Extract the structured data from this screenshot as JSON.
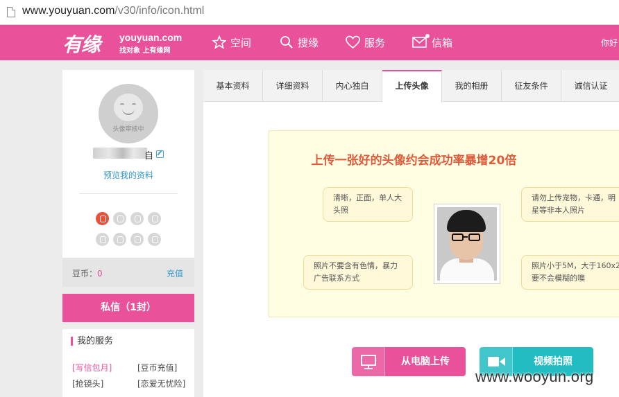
{
  "browser": {
    "url_host": "www.youyuan.com",
    "url_path": "/v30/info/icon.html"
  },
  "header": {
    "logo_cn": "有缘",
    "logo_en": "youyuan.com",
    "logo_slogan": "找对象 上有缘网",
    "nav": [
      {
        "label": "空间",
        "icon": "star-icon"
      },
      {
        "label": "搜缘",
        "icon": "search-icon"
      },
      {
        "label": "服务",
        "icon": "heart-icon"
      },
      {
        "label": "信箱",
        "icon": "mail-icon"
      }
    ],
    "greeting": "你好"
  },
  "profile": {
    "avatar_status": "头像审核中",
    "nickname_tail": "自",
    "preview_link": "预览我的资料",
    "coins_label": "豆币：",
    "coins_value": "0",
    "recharge_label": "充值",
    "private_msg_button": "私信（1封）"
  },
  "services": {
    "title": "我的服务",
    "items": [
      "[写信包月]",
      "[豆币充值]",
      "[抢镜头]",
      "[恋爱无忧险]"
    ]
  },
  "tabs": [
    "基本资料",
    "详细资料",
    "内心独白",
    "上传头像",
    "我的相册",
    "征友条件",
    "诚信认证"
  ],
  "active_tab": "上传头像",
  "upload": {
    "headline": "上传一张好的头像约会成功率暴增20倍",
    "tips": [
      "清晰，正面，单人大头照",
      "请勿上传宠物，卡通，明星等非本人照片",
      "照片不要含有色情，暴力广告联系方式",
      "照片小于5M，大于160x2要不会模糊的噢"
    ],
    "buttons": {
      "from_computer": "从电脑上传",
      "video_capture": "视频拍照"
    }
  },
  "watermark": "www.wooyun.org",
  "colors": {
    "brand_pink": "#e9519a",
    "teal": "#21bdc3",
    "link_blue": "#3399cc",
    "headline_red": "#e05a3a",
    "tip_bg": "#fffde2"
  }
}
